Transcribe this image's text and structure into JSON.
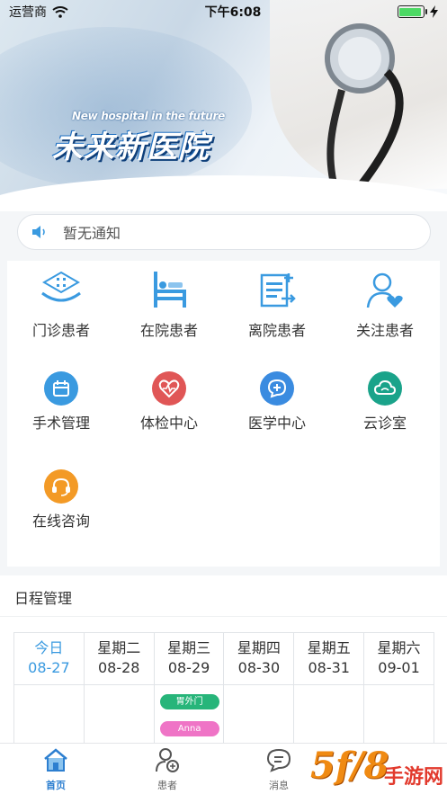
{
  "status_bar": {
    "carrier": "运营商",
    "time": "下午6:08",
    "battery_level": 0.95
  },
  "banner": {
    "logo_subtitle": "New hospital in the future",
    "logo_title": "未来新医院"
  },
  "notice": {
    "text": "暂无通知",
    "icon": "speaker-icon"
  },
  "grid": {
    "row1": [
      {
        "label": "门诊患者",
        "icon": "outpatient-icon"
      },
      {
        "label": "在院患者",
        "icon": "hospital-bed-icon"
      },
      {
        "label": "离院患者",
        "icon": "discharge-icon"
      },
      {
        "label": "关注患者",
        "icon": "follow-heart-icon"
      }
    ],
    "row2": [
      {
        "label": "手术管理",
        "icon": "calendar-icon",
        "color": "#3a9ae0"
      },
      {
        "label": "体检中心",
        "icon": "heart-pulse-icon",
        "color": "#e05656"
      },
      {
        "label": "医学中心",
        "icon": "medical-bubble-icon",
        "color": "#3a8be0"
      },
      {
        "label": "云诊室",
        "icon": "cloud-icon",
        "color": "#1aa38a"
      }
    ],
    "row3": [
      {
        "label": "在线咨询",
        "icon": "headset-icon",
        "color": "#f39a26"
      }
    ]
  },
  "schedule": {
    "title": "日程管理",
    "days": [
      {
        "weekday": "今日",
        "date": "08-27",
        "today": true
      },
      {
        "weekday": "星期二",
        "date": "08-28"
      },
      {
        "weekday": "星期三",
        "date": "08-29"
      },
      {
        "weekday": "星期四",
        "date": "08-30"
      },
      {
        "weekday": "星期五",
        "date": "08-31"
      },
      {
        "weekday": "星期六",
        "date": "09-01"
      }
    ],
    "events": [
      {
        "text": "胃外门",
        "color": "#27b57a"
      },
      {
        "text": "Anna",
        "color": "#ef74c6"
      }
    ]
  },
  "tabbar": {
    "home": "首页",
    "patients": "患者",
    "messages": "消息",
    "active_color": "#2d7fd0"
  },
  "watermark": {
    "big": "5f/8",
    "small": "手游网"
  }
}
